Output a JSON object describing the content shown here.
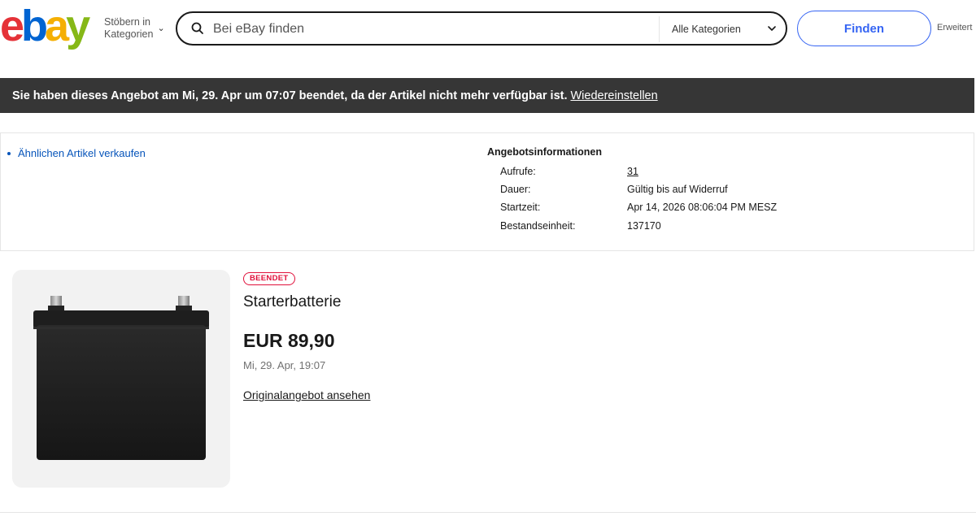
{
  "header": {
    "logo": {
      "letters": [
        "e",
        "b",
        "a",
        "y"
      ],
      "colors": [
        "#e53238",
        "#0064d2",
        "#f5af02",
        "#86b817"
      ]
    },
    "browse_line1": "Stöbern in",
    "browse_line2": "Kategorien",
    "search_placeholder": "Bei eBay finden",
    "category_select": "Alle Kategorien",
    "find_button": "Finden",
    "advanced_link": "Erweitert"
  },
  "banner": {
    "message": "Sie haben dieses Angebot am Mi, 29. Apr um 07:07 beendet, da der Artikel nicht mehr verfügbar ist.",
    "action_link": "Wiedereinstellen"
  },
  "info": {
    "sell_similar_link": "Ähnlichen Artikel verkaufen",
    "title": "Angebotsinformationen",
    "rows": [
      {
        "label": "Aufrufe:",
        "value": "31"
      },
      {
        "label": "Dauer:",
        "value": "Gültig bis auf Widerruf"
      },
      {
        "label": "Startzeit:",
        "value": "Apr 14, 2026 08:06:04 PM MESZ"
      },
      {
        "label": "Bestandseinheit:",
        "value": "137170"
      }
    ]
  },
  "product": {
    "status": "BEENDET",
    "title": "Starterbatterie",
    "price": "EUR 89,90",
    "end_date": "Mi, 29. Apr, 19:07",
    "original_link": "Originalangebot ansehen"
  },
  "colors": {
    "accent_blue": "#3665f3",
    "link_blue": "#0654ba",
    "banner_bg": "#363636",
    "status_red": "#e0103a"
  }
}
